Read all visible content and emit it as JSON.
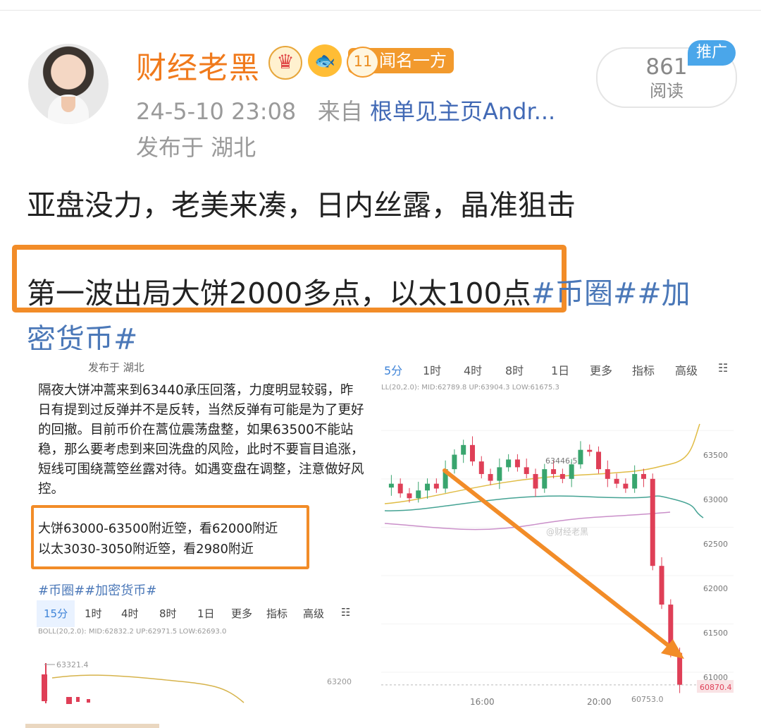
{
  "profile": {
    "name": "财经老黑",
    "fame_level": "11",
    "fame_label": "闻名一方",
    "time": "24-5-10 23:08",
    "source_prefix": "来自",
    "source_link": "根单见主页Andr...",
    "location": "发布于 湖北",
    "read_count": "861",
    "read_label": "阅读",
    "promo": "推广"
  },
  "post": {
    "line1": "亚盘没力，老美来凑，日内丝露，晶准狙击",
    "line2_main": "第一波出局大饼2000多点，以太100点",
    "line2_tags": "#币圈##加",
    "line3_tags": "密货币#"
  },
  "left_image": {
    "location": "发布于 湖北",
    "paragraph": "隔夜大饼冲蒿来到63440承压回落，力度明显较弱，昨日有提到过反弹并不是反转，当然反弹有可能是为了更好的回撤。目前币价在蒿位震荡盘整，如果63500不能站稳，那么要考虑到来回洗盘的风险，此时不要盲目追涨，短线可围绕蒿箜丝露对待。如遇变盘在调整，注意做好风控。",
    "highlight_1": "大饼63000-63500附近箜，看62000附近",
    "highlight_2": "以太3030-3050附近箜，看2980附近",
    "tags": "#币圈##加密货币#",
    "tabs": [
      "15分",
      "1时",
      "4时",
      "8时",
      "1日",
      "更多",
      "指标",
      "高级"
    ],
    "boll": "BOLL(20,2.0): MID:62832.2 UP:62971.5 LOW:62693.0",
    "mini_high": "63321.4",
    "mini_axis": "63200"
  },
  "right_image": {
    "tabs": [
      "5分",
      "1时",
      "4时",
      "8时",
      "1日",
      "更多",
      "指标",
      "高级"
    ],
    "boll": "LL(20,2.0): MID:62789.8 UP:63904.3 LOW:61675.3",
    "labels": {
      "peak": "63446.5",
      "current": "60870.4",
      "low": "60753.0",
      "time_1": "16:00",
      "time_2": "20:00",
      "watermark": "@财经老黑"
    },
    "y_ticks": [
      "63500",
      "63000",
      "62500",
      "62000",
      "61500",
      "61000"
    ]
  },
  "chart_data": {
    "type": "candlestick",
    "title": "",
    "xlabel": "",
    "ylabel": "",
    "ylim": [
      60650,
      63750
    ],
    "x": [
      "16:00",
      "20:00"
    ],
    "annotations": [
      "63446.5",
      "60870.4",
      "60753.0"
    ],
    "series": [
      {
        "values": [
          62950,
          62850,
          62800,
          62880,
          62950,
          62900,
          63100,
          63250,
          63350,
          63180,
          63050,
          62980,
          63120,
          63200,
          63120,
          63050,
          62900,
          63100,
          63050,
          63000,
          63150,
          63300,
          63280,
          63100,
          63000,
          62950,
          62900,
          63050,
          63000,
          62100,
          61700,
          61200,
          60870
        ]
      }
    ]
  },
  "colors": {
    "accent": "#f28c28",
    "link": "#4169b5",
    "tag": "#4b78b8",
    "up": "#39a56e",
    "down": "#df3f57"
  }
}
